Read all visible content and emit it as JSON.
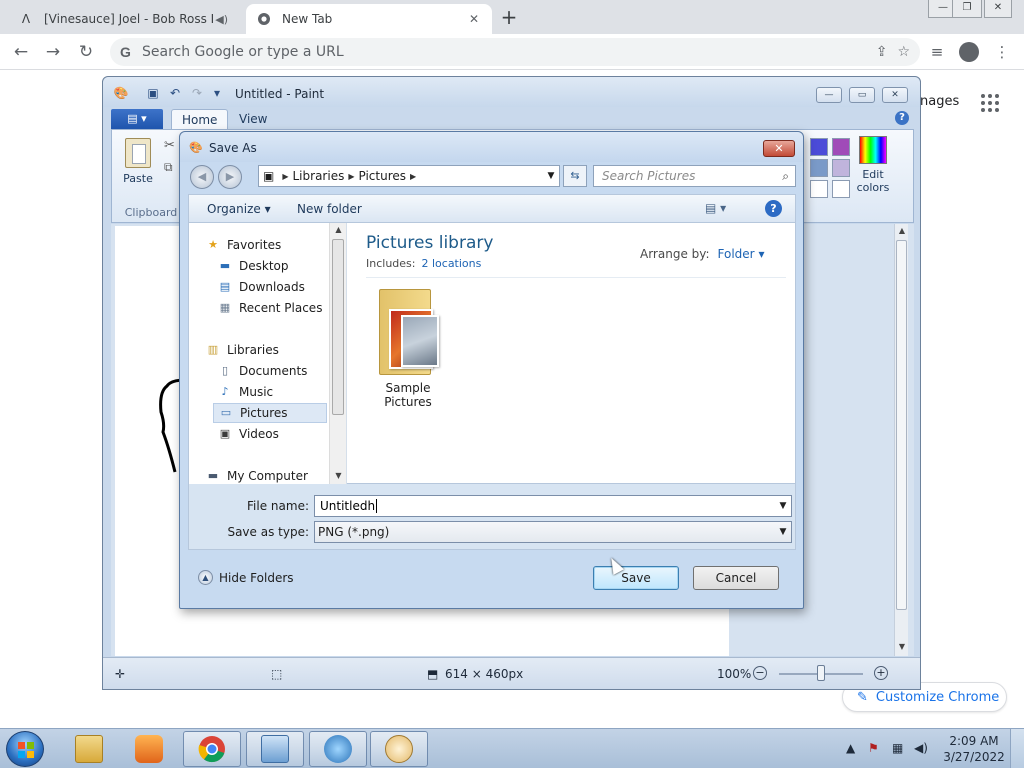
{
  "chrome": {
    "tabs": [
      {
        "title": "[Vinesauce] Joel - Bob Ross I",
        "active": false
      },
      {
        "title": "New Tab",
        "active": true
      }
    ],
    "omnibox_placeholder": "Search Google or type a URL",
    "newtab": {
      "images_link": "nages",
      "customize_label": "Customize Chrome"
    }
  },
  "paint": {
    "title": "Untitled - Paint",
    "ribbon_tabs": [
      "Home",
      "View"
    ],
    "paste_label": "Paste",
    "clipboard_group": "Clipboard",
    "edit_colors_label": "Edit colors",
    "swatch_colors": [
      "#4b4bd8",
      "#a04bb8",
      "#7a9ac8",
      "#c0b4dc",
      "#ffffff",
      "#ffffff"
    ],
    "status": {
      "dimensions": "614 × 460px",
      "zoom": "100%"
    }
  },
  "save_dialog": {
    "title": "Save As",
    "breadcrumb": [
      "Libraries",
      "Pictures"
    ],
    "search_placeholder": "Search Pictures",
    "toolbar": {
      "organize": "Organize",
      "new_folder": "New folder"
    },
    "nav": {
      "favorites": "Favorites",
      "desktop": "Desktop",
      "downloads": "Downloads",
      "recent_places": "Recent Places",
      "libraries": "Libraries",
      "documents": "Documents",
      "music": "Music",
      "pictures": "Pictures",
      "videos": "Videos",
      "my_computer": "My Computer"
    },
    "library": {
      "title": "Pictures library",
      "includes_label": "Includes:",
      "locations": "2 locations",
      "arrange_label": "Arrange by:",
      "arrange_value": "Folder"
    },
    "items": [
      {
        "name": "Sample Pictures"
      }
    ],
    "filename_label": "File name:",
    "filename_value": "Untitledh",
    "savetype_label": "Save as type:",
    "savetype_value": "PNG (*.png)",
    "hide_folders": "Hide Folders",
    "save_button": "Save",
    "cancel_button": "Cancel"
  },
  "taskbar": {
    "clock_time": "2:09 AM",
    "clock_date": "3/27/2022"
  }
}
